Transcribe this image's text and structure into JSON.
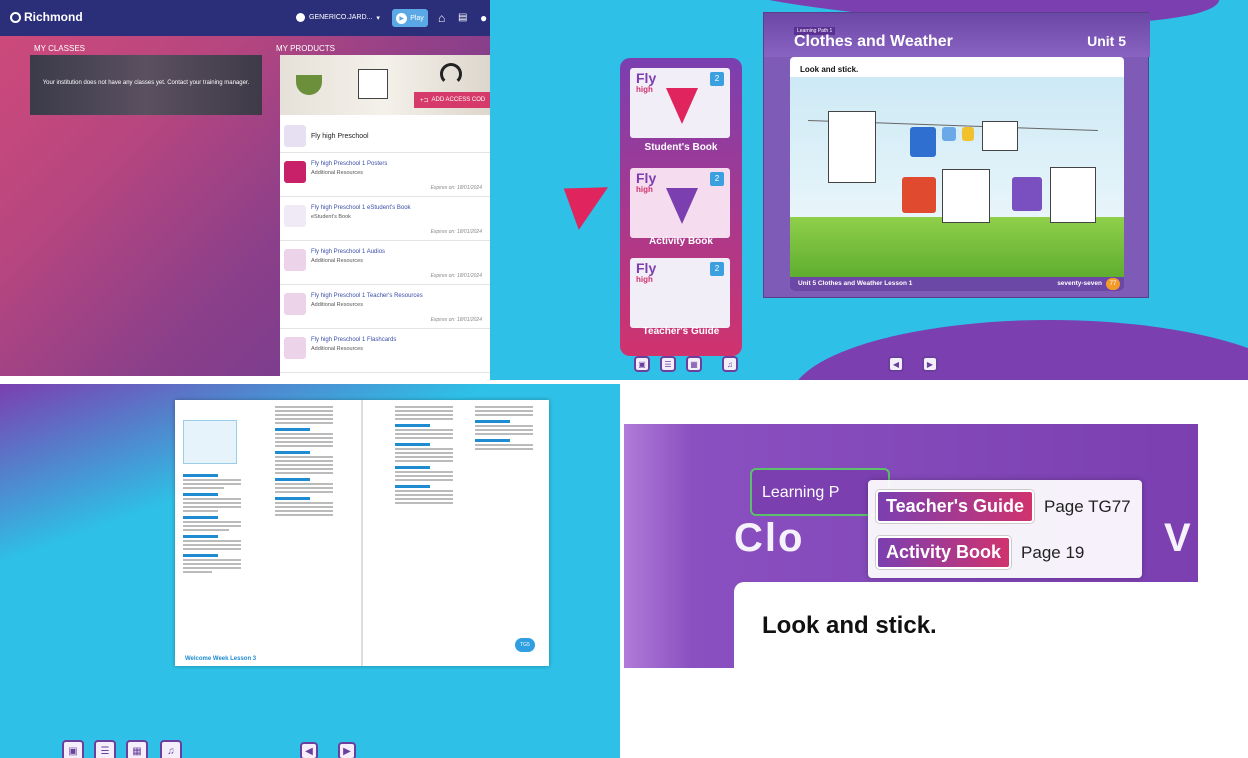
{
  "dashboard": {
    "brand": "Richmond",
    "user_name": "GENERICO.JARD...",
    "play_label": "Play",
    "my_classes_heading": "MY CLASSES",
    "my_products_heading": "MY PRODUCTS",
    "no_classes_message": "Your institution does not have any classes yet. Contact your training manager.",
    "add_access_code_label": "ADD ACCESS COD",
    "products": [
      {
        "title": "Fly high Preschool",
        "subtitle": "",
        "expires": ""
      },
      {
        "title": "Fly high Preschool 1 Posters",
        "subtitle": "Additional Resources",
        "expires": "Expires on: 18/01/2024"
      },
      {
        "title": "Fly high Preschool 1 eStudent's Book",
        "subtitle": "eStudent's Book",
        "expires": "Expires on: 18/01/2024"
      },
      {
        "title": "Fly high Preschool 1 Audios",
        "subtitle": "Additional Resources",
        "expires": "Expires on: 18/01/2024"
      },
      {
        "title": "Fly high Preschool 1 Teacher's Resources",
        "subtitle": "Additional Resources",
        "expires": "Expires on: 18/01/2024"
      },
      {
        "title": "Fly high Preschool 1 Flashcards",
        "subtitle": "Additional Resources",
        "expires": "Expires on: 18/01/2024"
      }
    ],
    "colors": {
      "topbar": "#2b2f7a",
      "link": "#3a4ea8",
      "accent": "#d63a6a"
    }
  },
  "books": {
    "covers": [
      {
        "brand": "Fly",
        "brand2": "high",
        "level": "2",
        "label": "Student's Book"
      },
      {
        "brand": "Fly",
        "brand2": "high",
        "level": "2",
        "label": "Activity Book"
      },
      {
        "brand": "Fly",
        "brand2": "high",
        "level": "2",
        "label": "Teacher's Guide"
      }
    ]
  },
  "lesson_page": {
    "tag": "Learning Path 1",
    "title": "Clothes and Weather",
    "unit": "Unit 5",
    "instruction": "Look and stick.",
    "footer_left": "Unit 5  Clothes and Weather  Lesson 1",
    "footer_right": "seventy-seven",
    "page_number": "77"
  },
  "teachers_guide": {
    "footer_section": "Welcome Week   Lesson 3",
    "page_badge": "TG5"
  },
  "zoom": {
    "tag": "Learning P",
    "big_title": "Clo",
    "big_title_end": "V",
    "instruction": "Look and stick.",
    "popup": [
      {
        "label": "Teacher's Guide",
        "page": "Page TG77"
      },
      {
        "label": "Activity Book",
        "page": "Page 19"
      }
    ]
  },
  "icons": {
    "user": "user-icon",
    "play": "play-icon",
    "home": "home-icon",
    "chat": "chat-icon",
    "add": "add-code-icon",
    "headphones": "headphones-icon",
    "prev": "prev-page-icon",
    "next": "next-page-icon",
    "thumbnails": "thumbnails-icon",
    "list": "list-icon",
    "grid": "grid-icon"
  }
}
